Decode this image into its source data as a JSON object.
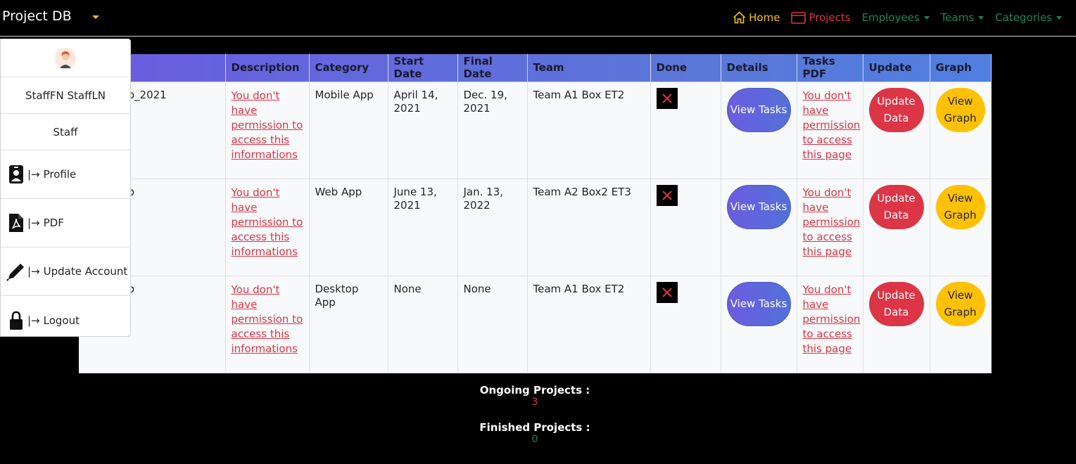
{
  "brand": "Project DB",
  "nav": {
    "home": "Home",
    "projects": "Projects",
    "employees": "Employees",
    "teams": "Teams",
    "categories": "Categories"
  },
  "profile_menu": {
    "name": "StaffFN StaffLN",
    "role": "Staff",
    "arrow": "|→",
    "profile": "Profile",
    "pdf": "PDF",
    "update_account": "Update Account",
    "logout": "Logout"
  },
  "table": {
    "headers": [
      "Description",
      "Category",
      "Start Date",
      "Final Date",
      "Team",
      "Done",
      "Details",
      "Tasks PDF",
      "Update",
      "Graph"
    ],
    "rows": [
      {
        "name": "pp_2021",
        "description": "You don't have permission to access this informations",
        "category": "Mobile App",
        "start": "April 14, 2021",
        "final": "Dec. 19, 2021",
        "team": "Team A1 Box ET2",
        "details": "View Tasks",
        "tasks_pdf": "You don't have permission to access this page",
        "update": "Update Data",
        "graph": "View Graph"
      },
      {
        "name": "pp",
        "description": "You don't have permission to access this informations",
        "category": "Web App",
        "start": "June 13, 2021",
        "final": "Jan. 13, 2022",
        "team": "Team A2 Box2 ET3",
        "details": "View Tasks",
        "tasks_pdf": "You don't have permission to access this page",
        "update": "Update Data",
        "graph": "View Graph"
      },
      {
        "name": "pp",
        "description": "You don't have permission to access this informations",
        "category": "Desktop App",
        "start": "None",
        "final": "None",
        "team": "Team A1 Box ET2",
        "details": "View Tasks",
        "tasks_pdf": "You don't have permission to access this page",
        "update": "Update Data",
        "graph": "View Graph"
      }
    ]
  },
  "stats": {
    "ongoing_label": "Ongoing Projects :",
    "ongoing_value": "3",
    "finished_label": "Finished Projects :",
    "finished_value": "0"
  },
  "colors": {
    "accent_yellow": "#ffc107",
    "accent_red": "#dc3545",
    "accent_green": "#198754",
    "header_gradient": "#6a5ce0"
  }
}
